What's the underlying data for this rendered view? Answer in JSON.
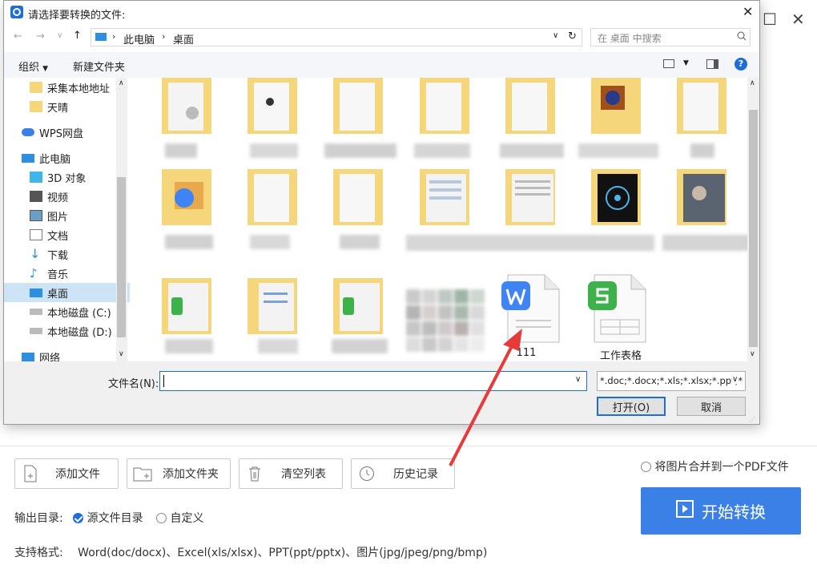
{
  "dialog": {
    "title": "请选择要转换的文件:",
    "breadcrumb": [
      "此电脑",
      "桌面"
    ],
    "search_placeholder": "在 桌面 中搜索",
    "toolbar": {
      "organize": "组织",
      "new_folder": "新建文件夹"
    },
    "nav": [
      {
        "label": "采集本地地址",
        "icon": "folder-icon"
      },
      {
        "label": "天晴",
        "icon": "folder-icon"
      },
      {
        "label": "WPS网盘",
        "icon": "cloud-icon"
      },
      {
        "label": "此电脑",
        "icon": "computer-icon"
      },
      {
        "label": "3D 对象",
        "icon": "cube-icon"
      },
      {
        "label": "视频",
        "icon": "video-icon"
      },
      {
        "label": "图片",
        "icon": "picture-icon"
      },
      {
        "label": "文档",
        "icon": "document-icon"
      },
      {
        "label": "下载",
        "icon": "download-icon"
      },
      {
        "label": "音乐",
        "icon": "music-icon"
      },
      {
        "label": "桌面",
        "icon": "desktop-icon",
        "selected": true
      },
      {
        "label": "本地磁盘 (C:)",
        "icon": "drive-icon"
      },
      {
        "label": "本地磁盘 (D:)",
        "icon": "drive-icon"
      },
      {
        "label": "网络",
        "icon": "network-icon"
      }
    ],
    "files": [
      {
        "name": "111",
        "type": "wps-document"
      },
      {
        "name": "工作表格",
        "type": "wps-spreadsheet"
      }
    ],
    "filename_label": "文件名(N):",
    "filename_value": "",
    "filetype_filter": "*.doc;*.docx;*.xls;*.xlsx;*.ppt;*",
    "open_button": "打开(O)",
    "cancel_button": "取消"
  },
  "app": {
    "buttons": [
      {
        "label": "添加文件",
        "icon": "add-file-icon"
      },
      {
        "label": "添加文件夹",
        "icon": "add-folder-icon"
      },
      {
        "label": "清空列表",
        "icon": "trash-icon"
      },
      {
        "label": "历史记录",
        "icon": "clock-icon"
      }
    ],
    "merge_option": "将图片合并到一个PDF文件",
    "output_label": "输出目录:",
    "output_source": "源文件目录",
    "output_custom": "自定义",
    "formats_label": "支持格式:",
    "formats_value": "Word(doc/docx)、Excel(xls/xlsx)、PPT(ppt/pptx)、图片(jpg/jpeg/png/bmp)",
    "start_button": "开始转换"
  },
  "colors": {
    "accent": "#3a80e6",
    "folder": "#f5d67a",
    "wps_blue": "#3f84f5",
    "wps_green": "#3db24a",
    "arrow": "#e83a3a"
  }
}
